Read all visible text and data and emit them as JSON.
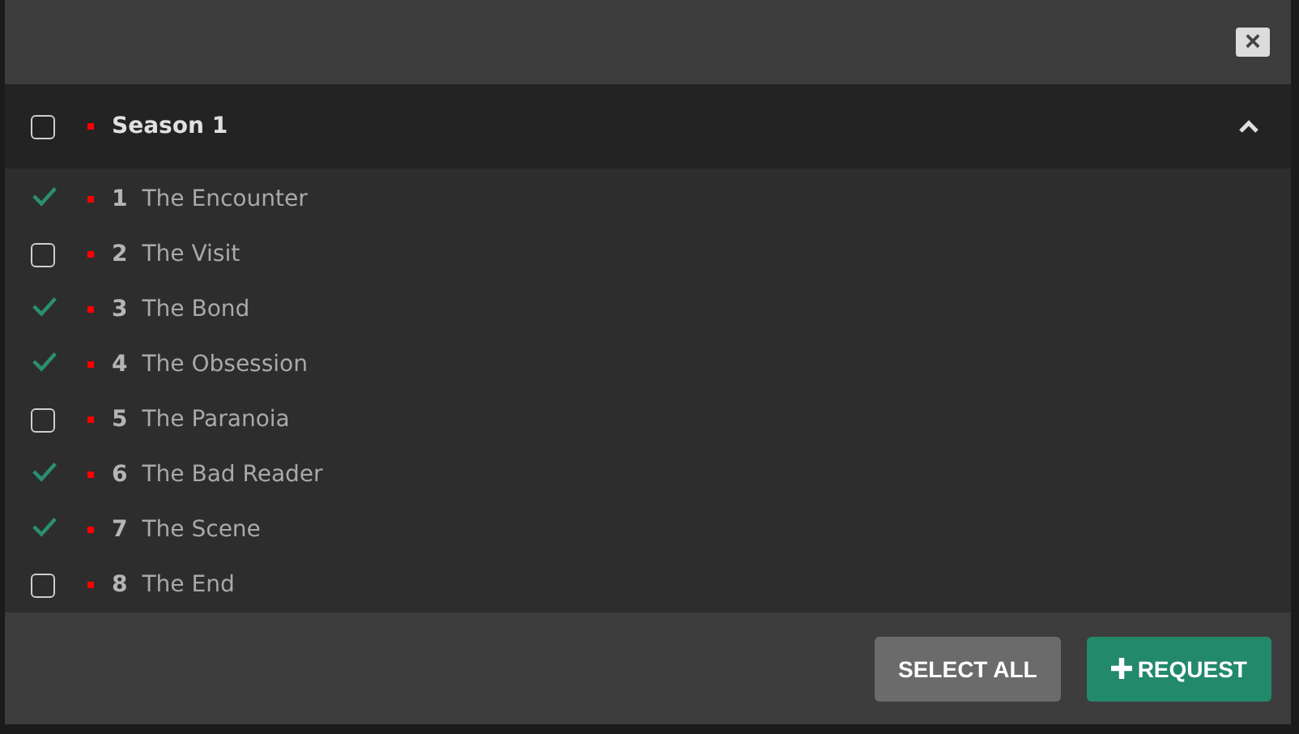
{
  "close_button": {
    "label": "×"
  },
  "season": {
    "title": "Season 1",
    "checked": false,
    "color": "#ff0000",
    "expanded": true
  },
  "episodes": [
    {
      "number": "1",
      "title": "The Encounter",
      "available": true,
      "color": "#ff0000"
    },
    {
      "number": "2",
      "title": "The Visit",
      "available": false,
      "checked": false,
      "color": "#ff0000"
    },
    {
      "number": "3",
      "title": "The Bond",
      "available": true,
      "color": "#ff0000"
    },
    {
      "number": "4",
      "title": "The Obsession",
      "available": true,
      "color": "#ff0000"
    },
    {
      "number": "5",
      "title": "The Paranoia",
      "available": false,
      "checked": false,
      "color": "#ff0000"
    },
    {
      "number": "6",
      "title": "The Bad Reader",
      "available": true,
      "color": "#ff0000"
    },
    {
      "number": "7",
      "title": "The Scene",
      "available": true,
      "color": "#ff0000"
    },
    {
      "number": "8",
      "title": "The End",
      "available": false,
      "checked": false,
      "color": "#ff0000"
    }
  ],
  "buttons": [
    {
      "kind": "secondary",
      "label": "SELECT ALL"
    },
    {
      "kind": "primary",
      "label": "REQUEST"
    }
  ]
}
